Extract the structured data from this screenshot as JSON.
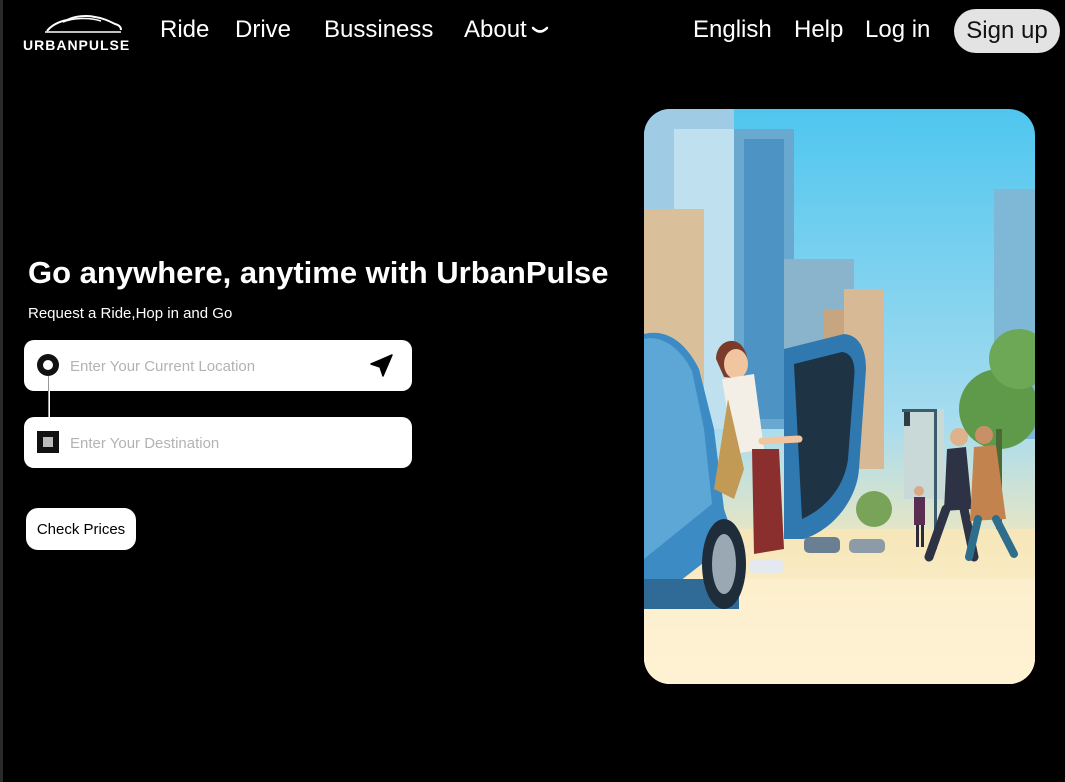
{
  "brand": {
    "name": "URBANPULSE"
  },
  "nav": {
    "ride": "Ride",
    "drive": "Drive",
    "business": "Bussiness",
    "about": "About",
    "about_icon": "chevron-down-icon",
    "language": "English",
    "help": "Help",
    "login": "Log in",
    "signup": "Sign up"
  },
  "hero": {
    "title": "Go anywhere, anytime with UrbanPulse",
    "subtitle": "Request a Ride,Hop in and Go",
    "pickup_placeholder": "Enter Your Current Location",
    "pickup_value": "",
    "destination_placeholder": "Enter Your Destination",
    "destination_value": "",
    "check_prices": "Check Prices"
  },
  "colors": {
    "background": "#000000",
    "text": "#ffffff",
    "signup_bg": "#e3e3e3",
    "input_bg": "#ffffff",
    "placeholder": "#b3b3b3"
  },
  "icons": {
    "pickup": "location-pin-icon",
    "destination": "destination-square-icon",
    "locate": "navigation-arrow-icon",
    "logo": "car-logo-icon"
  }
}
